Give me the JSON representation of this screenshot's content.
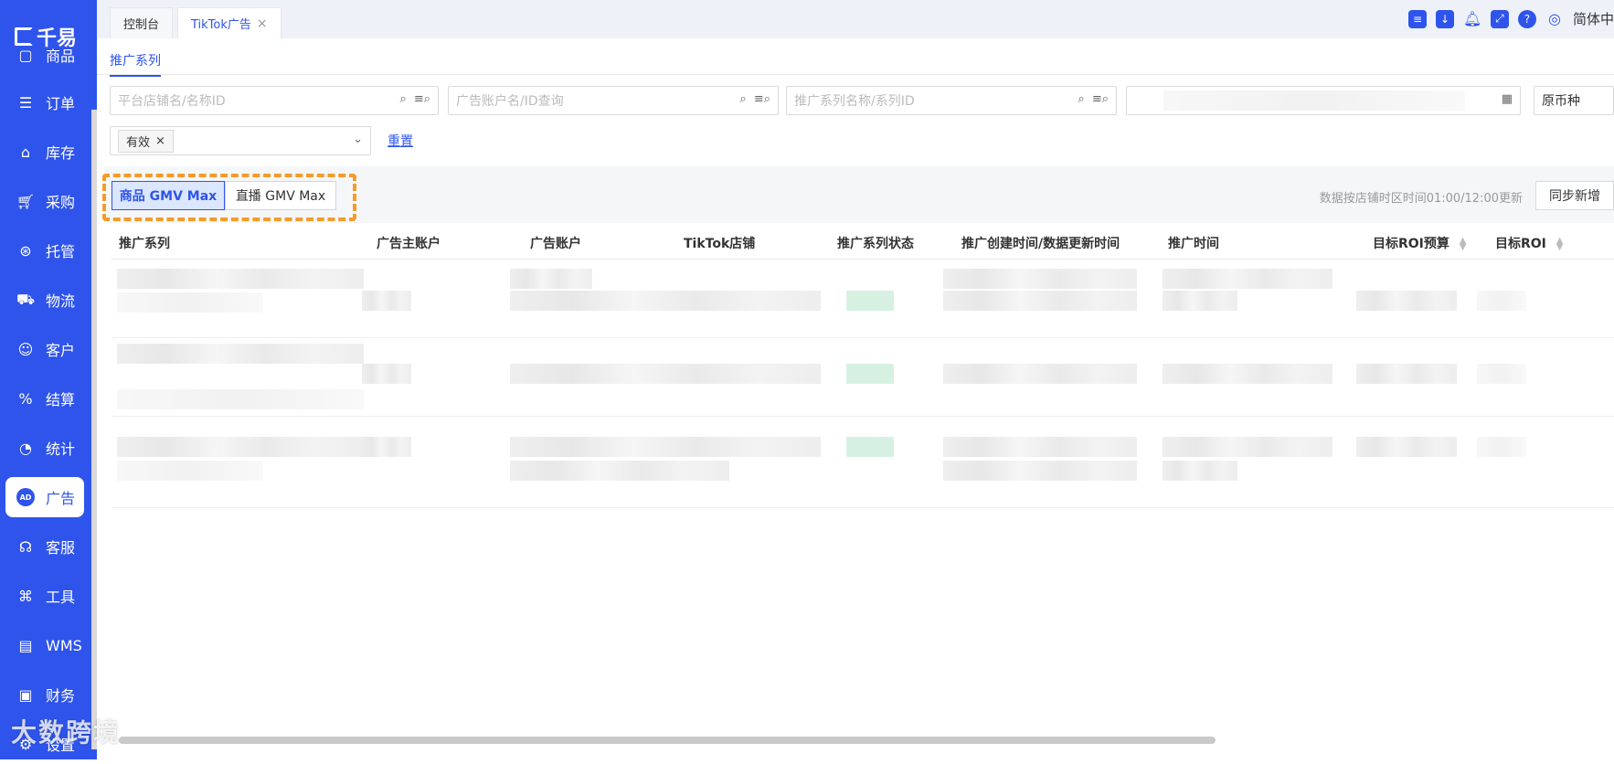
{
  "app": {
    "logo_text": "千易"
  },
  "sidebar": {
    "items": [
      {
        "label": "商品",
        "icon": "product-icon"
      },
      {
        "label": "订单",
        "icon": "order-icon"
      },
      {
        "label": "库存",
        "icon": "warehouse-icon"
      },
      {
        "label": "采购",
        "icon": "cart-icon"
      },
      {
        "label": "托管",
        "icon": "hosting-icon"
      },
      {
        "label": "物流",
        "icon": "truck-icon"
      },
      {
        "label": "客户",
        "icon": "customer-icon"
      },
      {
        "label": "结算",
        "icon": "settlement-icon"
      },
      {
        "label": "统计",
        "icon": "pie-chart-icon"
      },
      {
        "label": "广告",
        "icon": "ad-icon",
        "badge": "AD"
      },
      {
        "label": "客服",
        "icon": "headset-icon"
      },
      {
        "label": "工具",
        "icon": "command-icon"
      },
      {
        "label": "WMS",
        "icon": "wms-icon"
      },
      {
        "label": "财务",
        "icon": "wallet-icon"
      },
      {
        "label": "设置",
        "icon": "gear-icon"
      }
    ]
  },
  "tabs": [
    {
      "label": "控制台"
    },
    {
      "label": "TikTok广告",
      "close": "×"
    }
  ],
  "topbar": {
    "language": "简体中"
  },
  "subtab": {
    "label": "推广系列"
  },
  "filters": {
    "shop_placeholder": "平台店铺名/名称ID",
    "account_placeholder": "广告账户名/ID查询",
    "series_placeholder": "推广系列名称/系列ID",
    "currency": "原币种",
    "status_tag": "有效",
    "reset_label": "重置"
  },
  "segment": {
    "product_gmv": "商品 GMV Max",
    "live_gmv": "直播 GMV Max"
  },
  "sync_note": "数据按店铺时区时间01:00/12:00更新",
  "sync_button": "同步新增",
  "table": {
    "headers": [
      "推广系列",
      "广告主账户",
      "广告账户",
      "TikTok店铺",
      "推广系列状态",
      "推广创建时间/数据更新时间",
      "推广时间",
      "目标ROI预算",
      "目标ROI"
    ]
  },
  "watermark": "大数跨境",
  "colors": {
    "primary": "#2f54eb",
    "highlight": "#f39c2c"
  }
}
